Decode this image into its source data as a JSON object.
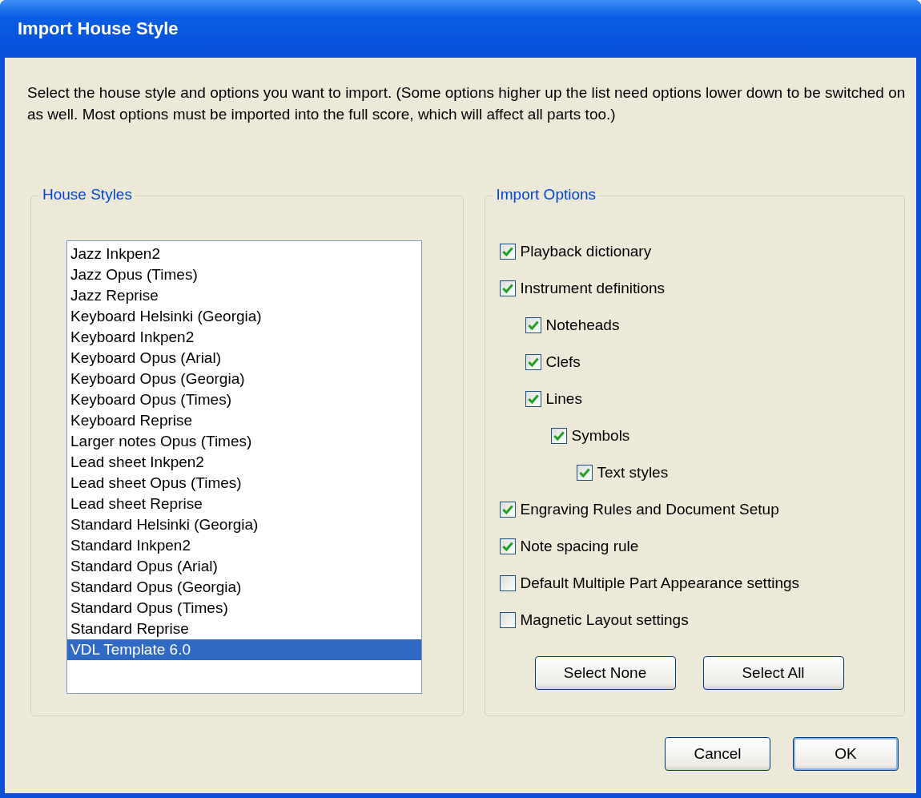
{
  "window": {
    "title": "Import House Style"
  },
  "description": "Select the house style and options you want to import. (Some options higher up the list need options lower down to be switched on as well. Most options must be imported into the full score, which will affect all parts too.)",
  "house_styles": {
    "title": "House Styles",
    "items": [
      {
        "label": "Jazz Inkpen2",
        "selected": false
      },
      {
        "label": "Jazz Opus (Times)",
        "selected": false
      },
      {
        "label": "Jazz Reprise",
        "selected": false
      },
      {
        "label": "Keyboard Helsinki (Georgia)",
        "selected": false
      },
      {
        "label": "Keyboard Inkpen2",
        "selected": false
      },
      {
        "label": "Keyboard Opus (Arial)",
        "selected": false
      },
      {
        "label": "Keyboard Opus (Georgia)",
        "selected": false
      },
      {
        "label": "Keyboard Opus (Times)",
        "selected": false
      },
      {
        "label": "Keyboard Reprise",
        "selected": false
      },
      {
        "label": "Larger notes Opus (Times)",
        "selected": false
      },
      {
        "label": "Lead sheet Inkpen2",
        "selected": false
      },
      {
        "label": "Lead sheet Opus (Times)",
        "selected": false
      },
      {
        "label": "Lead sheet Reprise",
        "selected": false
      },
      {
        "label": "Standard Helsinki (Georgia)",
        "selected": false
      },
      {
        "label": "Standard Inkpen2",
        "selected": false
      },
      {
        "label": "Standard Opus (Arial)",
        "selected": false
      },
      {
        "label": "Standard Opus (Georgia)",
        "selected": false
      },
      {
        "label": "Standard Opus (Times)",
        "selected": false
      },
      {
        "label": "Standard Reprise",
        "selected": false
      },
      {
        "label": "VDL Template 6.0",
        "selected": true
      }
    ]
  },
  "import_options": {
    "title": "Import Options",
    "options": [
      {
        "label": "Playback dictionary",
        "checked": true
      },
      {
        "label": "Instrument definitions",
        "checked": true,
        "children": [
          {
            "label": "Noteheads",
            "checked": true
          },
          {
            "label": "Clefs",
            "checked": true
          },
          {
            "label": "Lines",
            "checked": true,
            "children": [
              {
                "label": "Symbols",
                "checked": true,
                "children": [
                  {
                    "label": "Text styles",
                    "checked": true
                  }
                ]
              }
            ]
          }
        ]
      },
      {
        "label": "Engraving Rules and Document Setup",
        "checked": true
      },
      {
        "label": "Note spacing rule",
        "checked": true
      },
      {
        "label": "Default Multiple Part Appearance settings",
        "checked": false
      },
      {
        "label": "Magnetic Layout settings",
        "checked": false
      }
    ],
    "buttons": [
      "Select None",
      "Select All"
    ]
  },
  "buttons": [
    "Cancel",
    "OK"
  ]
}
